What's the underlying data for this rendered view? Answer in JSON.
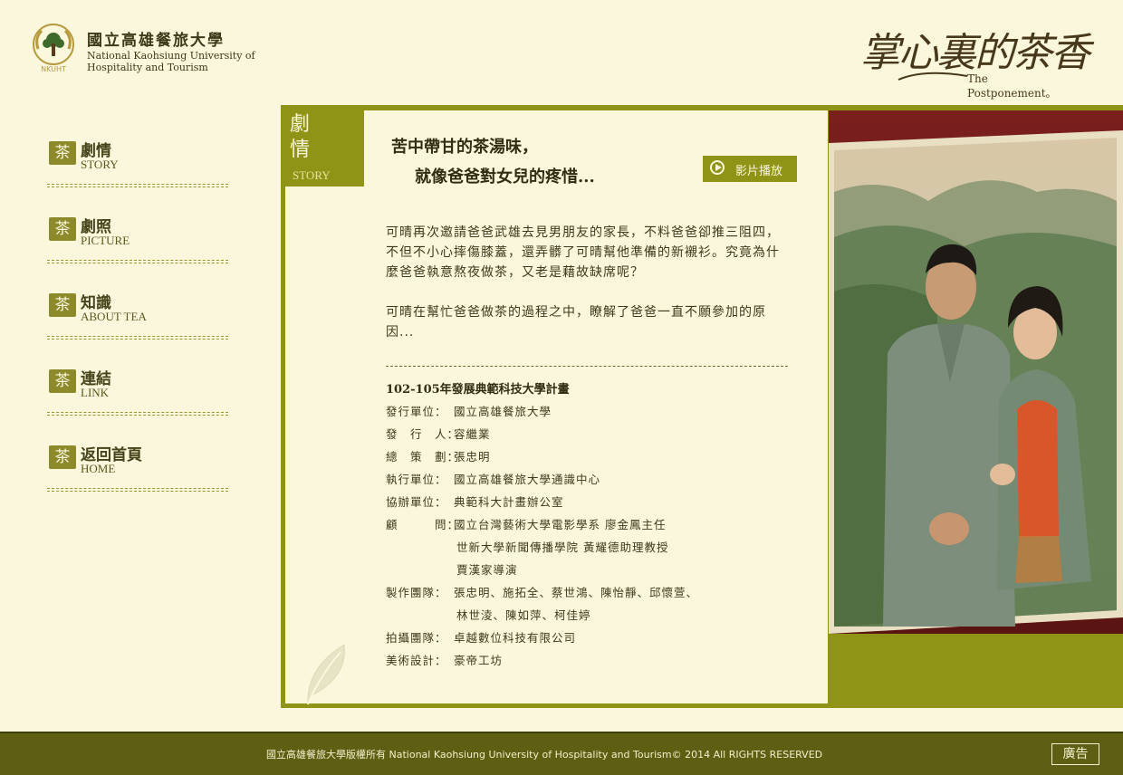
{
  "header": {
    "logo_zh": "國立高雄餐旅大學",
    "logo_en_line1": "National Kaohsiung University of",
    "logo_en_line2": "Hospitality and Tourism",
    "logo_emblem_text": "NKUHT",
    "brand_title": "掌心裏的茶香",
    "brand_sub_the": "The",
    "brand_sub": "Postponement。"
  },
  "nav": {
    "icon_glyph": "茶",
    "items": [
      {
        "zh": "劇情",
        "en": "STORY"
      },
      {
        "zh": "劇照",
        "en": "PICTURE"
      },
      {
        "zh": "知識",
        "en": "ABOUT TEA"
      },
      {
        "zh": "連結",
        "en": "LINK"
      },
      {
        "zh": "返回首頁",
        "en": "HOME"
      }
    ]
  },
  "section": {
    "title_zh": "劇情",
    "title_en": "STORY"
  },
  "tagline": {
    "line1": "苦中帶甘的茶湯味，",
    "line2": "就像爸爸對女兒的疼惜..."
  },
  "play_button_label": "影片播放",
  "story": {
    "paragraph1": "可晴再次邀請爸爸武雄去見男朋友的家長，不料爸爸卻推三阻四，不但不小心摔傷膝蓋，還弄髒了可晴幫他準備的新襯衫。究竟為什麼爸爸執意熬夜做茶，又老是藉故缺席呢？",
    "paragraph2": "可晴在幫忙爸爸做茶的過程之中，瞭解了爸爸一直不願參加的原因..."
  },
  "credits": {
    "title": "102-105年發展典範科技大學計畫",
    "rows": [
      {
        "label": "發行單位：",
        "value": "國立高雄餐旅大學"
      },
      {
        "label": "發　行　人：",
        "value": "容繼業"
      },
      {
        "label": "總　策　劃：",
        "value": "張忠明"
      },
      {
        "label": "執行單位：",
        "value": "國立高雄餐旅大學通識中心"
      },
      {
        "label": "協辦單位：",
        "value": "典範科大計畫辦公室"
      },
      {
        "label": "顧　　　問：",
        "value": "國立台灣藝術大學電影學系 廖金鳳主任"
      },
      {
        "label": "",
        "value": "世新大學新聞傳播學院 黃耀德助理教授"
      },
      {
        "label": "",
        "value": "賈漢家導演"
      },
      {
        "label": "製作團隊：",
        "value": "張忠明、施拓全、蔡世鴻、陳怡靜、邱懷萱、"
      },
      {
        "label": "",
        "value": "林世淩、陳如萍、柯佳婷"
      },
      {
        "label": "拍攝團隊：",
        "value": "卓越數位科技有限公司"
      },
      {
        "label": "美術設計：",
        "value": "豪帝工坊"
      }
    ]
  },
  "footer": {
    "copyright": "國立高雄餐旅大學版權所有 National Kaohsiung University of Hospitality and Tourism© 2014 All RIGHTS RESERVED",
    "ad_label": "廣告"
  },
  "colors": {
    "background": "#fbf7dc",
    "accent": "#8f9417",
    "footer": "#5f5f14",
    "text": "#3d3a1c"
  }
}
